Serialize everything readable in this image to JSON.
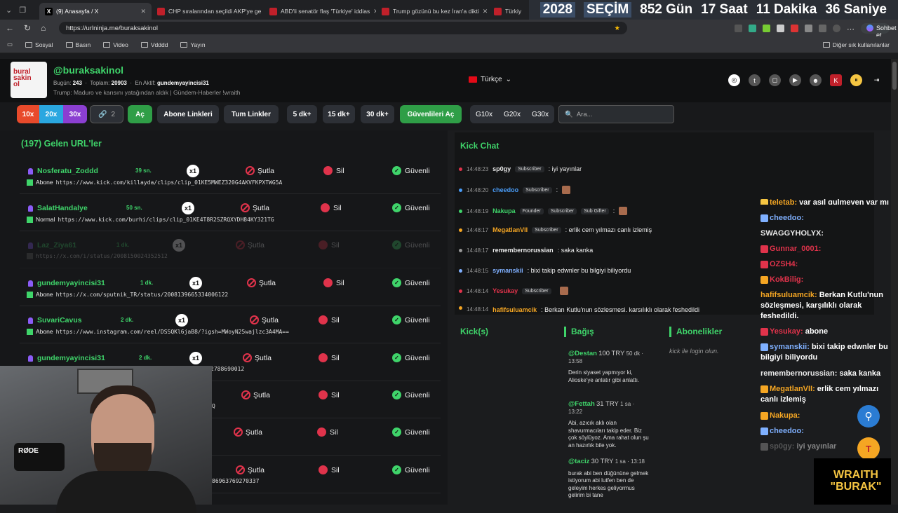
{
  "tabs": [
    {
      "title": "(9) Anasayfa / X",
      "fav": "X",
      "color": "#000000"
    },
    {
      "title": "CHP sıralarından seçildi AKP'ye ge",
      "fav": "",
      "color": "#c0202a"
    },
    {
      "title": "ABD'li senatör flaş 'Türkiye' iddias",
      "fav": "",
      "color": "#c0202a"
    },
    {
      "title": "Trump gözünü bu kez İran'a dikti",
      "fav": "",
      "color": "#c0202a"
    },
    {
      "title": "Türkiy",
      "fav": "",
      "color": "#c0202a"
    }
  ],
  "countdown": {
    "year": "2028",
    "word": "SEÇİM",
    "days": "852 Gün",
    "hours": "17 Saat",
    "minutes": "11 Dakika",
    "seconds": "36 Saniye"
  },
  "browser": {
    "url": "https://urlninja.me/buraksakinol",
    "profile_button": "Sohbet et"
  },
  "bookmarks": [
    "Sosyal",
    "Basın",
    "Video",
    "Vdddd",
    "Yayın"
  ],
  "bookmarks_right": "Diğer sık kullanılanlar",
  "header": {
    "logo_lines": [
      "bural",
      "sakin",
      "ol"
    ],
    "username": "@buraksakinol",
    "today_label": "Bugün:",
    "today_value": "243",
    "total_label": "Toplam:",
    "total_value": "20903",
    "active_label": "En Aktif:",
    "active_value": "gundemyayincisi31",
    "subtitle": "Trump: Maduro ve karısını yatağından aldık | Gündem-Haberler !wraith",
    "language": "Türkçe"
  },
  "toolbar": {
    "b10x": "10x",
    "b20x": "20x",
    "b30x": "30x",
    "link_count": "2",
    "ac": "Aç",
    "abone": "Abone Linkleri",
    "tum": "Tum Linkler",
    "d5": "5 dk+",
    "d15": "15 dk+",
    "d30": "30 dk+",
    "guvenli_ac": "Güvenlileri Aç",
    "g10": "G10x",
    "g20": "G20x",
    "g30": "G30x",
    "search_placeholder": "Ara..."
  },
  "left_title": "(197) Gelen URL'ler",
  "actions": {
    "sutla": "Şutla",
    "sil": "Sil",
    "guvenli": "Güvenli"
  },
  "rows": [
    {
      "name": "Nosferatu_Zoddd",
      "time": "39 sn.",
      "count": "x1",
      "type": "Abone",
      "url": "https://www.kick.com/killayda/clips/clip_01KE5MWEZ320G4AKVFKPXTWG5A"
    },
    {
      "name": "SalatHandalye",
      "time": "50 sn.",
      "count": "x1",
      "type": "Normal",
      "url": "https://www.kick.com/burhi/clips/clip_01KE4T8R2SZRQXYDH84KY321TG"
    },
    {
      "name": "Laz_Ziya61",
      "time": "1 dk.",
      "count": "x1",
      "type": "",
      "url": "https://x.com/i/status/2008150024352512"
    },
    {
      "name": "gundemyayincisi31",
      "time": "1 dk.",
      "count": "x1",
      "type": "Abone",
      "url": "https://x.com/sputnik_TR/status/2008139665334006122"
    },
    {
      "name": "SuvariCavus",
      "time": "2 dk.",
      "count": "x1",
      "type": "Abone",
      "url": "https://www.instagram.com/reel/DSSQKl6jaB8/?igsh=MWoyN25wajlzc3A4MA=="
    },
    {
      "name": "gundemyayincisi31",
      "time": "2 dk.",
      "count": "x1",
      "type": "",
      "url": "2788690012"
    },
    {
      "name": "",
      "time": "",
      "count": "",
      "type": "",
      "url": "Q"
    },
    {
      "name": "",
      "time": "",
      "count": "",
      "type": "",
      "url": ""
    },
    {
      "name": "",
      "time": "",
      "count": "",
      "type": "",
      "url": "86963769270337"
    }
  ],
  "kick": {
    "title": "Kick Chat",
    "messages": [
      {
        "time": "14:48:23",
        "user": "sp0gy",
        "ucolor": "#e8e8e8",
        "badges": [
          "Subscriber"
        ],
        "text": ": iyi yayınlar",
        "dot": "#e0334b"
      },
      {
        "time": "14:48:20",
        "user": "cheedoo",
        "ucolor": "#4a9df8",
        "badges": [
          "Subscriber"
        ],
        "text": ":",
        "dot": "#4a9df8"
      },
      {
        "time": "14:48:19",
        "user": "Nakupa",
        "ucolor": "#3fd46a",
        "badges": [
          "Founder",
          "Subscriber",
          "Sub Gifter"
        ],
        "text": ":",
        "dot": "#3fd46a"
      },
      {
        "time": "14:48:17",
        "user": "MegatlanVII",
        "ucolor": "#f5a623",
        "badges": [
          "Subscriber"
        ],
        "text": ": erlik cem yılmazı canlı izlemiş",
        "dot": "#f5a623"
      },
      {
        "time": "14:48:17",
        "user": "remembernorussian",
        "ucolor": "#e8e8e8",
        "badges": [],
        "text": ": saka kanka",
        "dot": "#999999"
      },
      {
        "time": "14:48:15",
        "user": "symanskii",
        "ucolor": "#7fb0ff",
        "badges": [],
        "text": ": bixi takip edwnler bu bilgiyi biliyordu",
        "dot": "#7fb0ff"
      },
      {
        "time": "14:48:14",
        "user": "Yesukay",
        "ucolor": "#e0334b",
        "badges": [
          "Subscriber"
        ],
        "text": "",
        "dot": "#e0334b"
      },
      {
        "time": "14:48:14",
        "user": "hafifsuluamcik",
        "ucolor": "#f5a623",
        "badges": [],
        "text": ": Berkan Kutlu'nun sözleşmesi, karşılıklı olarak feshedildi",
        "dot": "#f5a623"
      }
    ]
  },
  "overlay_chat": [
    {
      "user": "teletab:",
      "text": "var asıl gulmeyen var mı",
      "color": "#f5a623"
    },
    {
      "user": "cheedoo:",
      "text": "",
      "color": "#7fb0ff"
    },
    {
      "user": "SWAGGYHOLYX:",
      "text": "",
      "color": "#e8e8e8"
    },
    {
      "user": "Gunnar_0001:",
      "text": "",
      "color": "#e0334b"
    },
    {
      "user": "OZSH4:",
      "text": "",
      "color": "#e0334b"
    },
    {
      "user": "KokBilig:",
      "text": "",
      "color": "#e0334b"
    },
    {
      "user": "hafifsuluamcik:",
      "text": "Berkan Kutlu'nun sözleşmesi, karşılıklı olarak feshedildi.",
      "color": "#f5a623"
    },
    {
      "user": "Yesukay:",
      "text": "abone",
      "color": "#e0334b"
    },
    {
      "user": "symanskii:",
      "text": "bixi takip edwnler bu bilgiyi biliyordu",
      "color": "#7fb0ff"
    },
    {
      "user": "remembernorussian:",
      "text": "saka kanka",
      "color": "#e8e8e8"
    },
    {
      "user": "MegatlanVII:",
      "text": "erlik cem yılmazı canlı izlemiş",
      "color": "#f5a623"
    },
    {
      "user": "Nakupa:",
      "text": "",
      "color": "#f5a623"
    },
    {
      "user": "cheedoo:",
      "text": "",
      "color": "#7fb0ff"
    },
    {
      "user": "sp0gy:",
      "text": "iyi yayınlar",
      "color": "#999999"
    }
  ],
  "bottom": {
    "kicks_title": "Kick(s)",
    "bagis_title": "Bağış",
    "abone_title": "Abonelikler",
    "abone_empty": "kick ile login olun.",
    "donations": [
      {
        "name": "@Destan",
        "amount": "100 TRY",
        "time": "50 dk · 13:58",
        "text": "Derin siyaset yapmıyor ki, Alioske'ye anlatır gibi anlattı."
      },
      {
        "name": "@Fettah",
        "amount": "31 TRY",
        "time": "1 sa · 13:22",
        "text": "Abi, azıcık aklı olan shavurmacıları takip eder. Biz çok söylüyoz. Ama rahat olun şu an hazırlık bile yok."
      },
      {
        "name": "@taciz",
        "amount": "30 TRY",
        "time": "1 sa · 13:18",
        "text": "burak abi ben düğününe gelmek istiyorum abi lutfen ben de geleyim herkes geliyormus gelirim bi tane"
      }
    ]
  },
  "webcam": {
    "mic_label": "RØDE"
  },
  "wraith": {
    "line1": "WRAITH",
    "line2": "\"BURAK\""
  },
  "fab_t": "T"
}
